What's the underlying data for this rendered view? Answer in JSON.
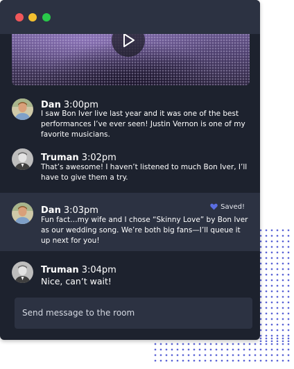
{
  "window": {
    "controls": [
      "close",
      "minimize",
      "maximize"
    ],
    "colors": {
      "close": "#f0575a",
      "minimize": "#f3bf2f",
      "maximize": "#29c84a",
      "background": "#1d222e",
      "highlight": "#2c3242"
    }
  },
  "video": {
    "icon": "play-icon"
  },
  "messages": [
    {
      "name": "Dan",
      "time": "3:00pm",
      "text": "I saw Bon Iver live last year and it was one of the best performances I’ve ever seen! Justin Vernon is one of my favorite musicians.",
      "highlighted": false
    },
    {
      "name": "Truman",
      "time": "3:02pm",
      "text": "That’s awesome! I haven’t listened to much Bon Iver, I’ll have to give them a try.",
      "highlighted": false
    },
    {
      "name": "Dan",
      "time": "3:03pm",
      "text": "Fun fact…my wife and I chose “Skinny Love” by Bon Iver as our wedding song. We’re both big fans—I’ll queue it up next for you!",
      "highlighted": true,
      "saved_label": "Saved!",
      "saved_icon": "heart-icon",
      "saved_color": "#5b6ee1"
    },
    {
      "name": "Truman",
      "time": "3:04pm",
      "text": "Nice, can’t wait!",
      "highlighted": false
    }
  ],
  "composer": {
    "placeholder": "Send message to the room"
  },
  "decor": {
    "dot_color": "#5a63d6"
  }
}
